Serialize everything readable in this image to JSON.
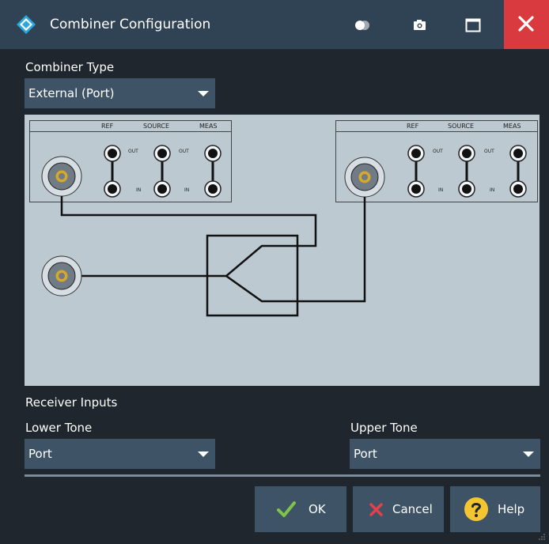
{
  "window": {
    "title": "Combiner Configuration"
  },
  "combiner_type": {
    "label": "Combiner Type",
    "value": "External (Port)"
  },
  "diagram": {
    "left_unit": {
      "ref": "REF",
      "source": "SOURCE",
      "meas": "MEAS",
      "out": "OUT",
      "in": "IN"
    },
    "right_unit": {
      "ref": "REF",
      "source": "SOURCE",
      "meas": "MEAS",
      "out": "OUT",
      "in": "IN"
    }
  },
  "receiver_inputs": {
    "heading": "Receiver Inputs"
  },
  "lower_tone": {
    "label": "Lower Tone",
    "value": "Port"
  },
  "upper_tone": {
    "label": "Upper Tone",
    "value": "Port"
  },
  "buttons": {
    "ok": "OK",
    "cancel": "Cancel",
    "help": "Help"
  },
  "icons": {
    "app_logo": "rohde-schwarz-logo-icon",
    "toggle": "transparency-toggle-icon",
    "screenshot": "camera-icon",
    "maximize": "maximize-icon",
    "close": "close-icon",
    "ok": "check-icon",
    "cancel": "x-icon",
    "help": "question-icon"
  },
  "colors": {
    "titlebar": "#304355",
    "background": "#1f262d",
    "control": "#3e5366",
    "close": "#d83a40",
    "diagram_bg": "#bcc9d1",
    "connector_pin": "#d6a92a",
    "ok_check": "#7ec44a",
    "cancel_x": "#e0414a",
    "help_circle": "#f2c531"
  }
}
